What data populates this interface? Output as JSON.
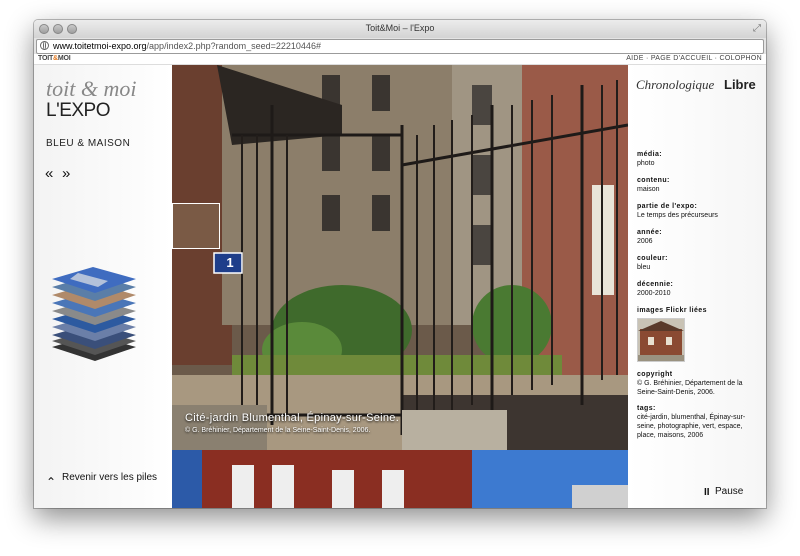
{
  "window": {
    "title": "Toit&Moi – l'Expo",
    "url_host": "www.toitetmoi-expo.org",
    "url_path": "/app/index2.php?random_seed=22210446#"
  },
  "topbar": {
    "logo_a": "TOIT",
    "logo_amp": "&",
    "logo_b": "MOI",
    "links": "AIDE · PAGE D'ACCUEIL · COLOPHON"
  },
  "left": {
    "brand_line1": "toit & moi",
    "brand_line2": "L'EXPO",
    "subtitle": "BLEU & MAISON",
    "prev_glyph": "«",
    "next_glyph": "»",
    "back_glyph": "⌃",
    "back_label": "Revenir vers les piles"
  },
  "photo": {
    "sign_number": "1",
    "caption": "Cité-jardin Blumenthal, Épinay-sur-Seine.",
    "credit": "© G. Bréhinier, Département de la Seine-Saint-Denis, 2006."
  },
  "right": {
    "mode_chrono": "Chronologique",
    "mode_libre": "Libre",
    "fields": [
      {
        "label": "média:",
        "value": "photo"
      },
      {
        "label": "contenu:",
        "value": "maison"
      },
      {
        "label": "partie de l'expo:",
        "value": "Le temps des précurseurs"
      },
      {
        "label": "année:",
        "value": "2006"
      },
      {
        "label": "couleur:",
        "value": "bleu"
      },
      {
        "label": "décennie:",
        "value": "2000-2010"
      },
      {
        "label": "images Flickr liées",
        "value": ""
      },
      {
        "label": "copyright",
        "value": "© G. Bréhinier, Département de la Seine-Saint-Denis, 2006."
      },
      {
        "label": "tags:",
        "value": "cité-jardin, blumenthal, Épinay-sur-seine, photographie, vert, espace, place, maisons, 2006"
      }
    ],
    "pause_glyph": "II",
    "pause_label": "Pause"
  }
}
